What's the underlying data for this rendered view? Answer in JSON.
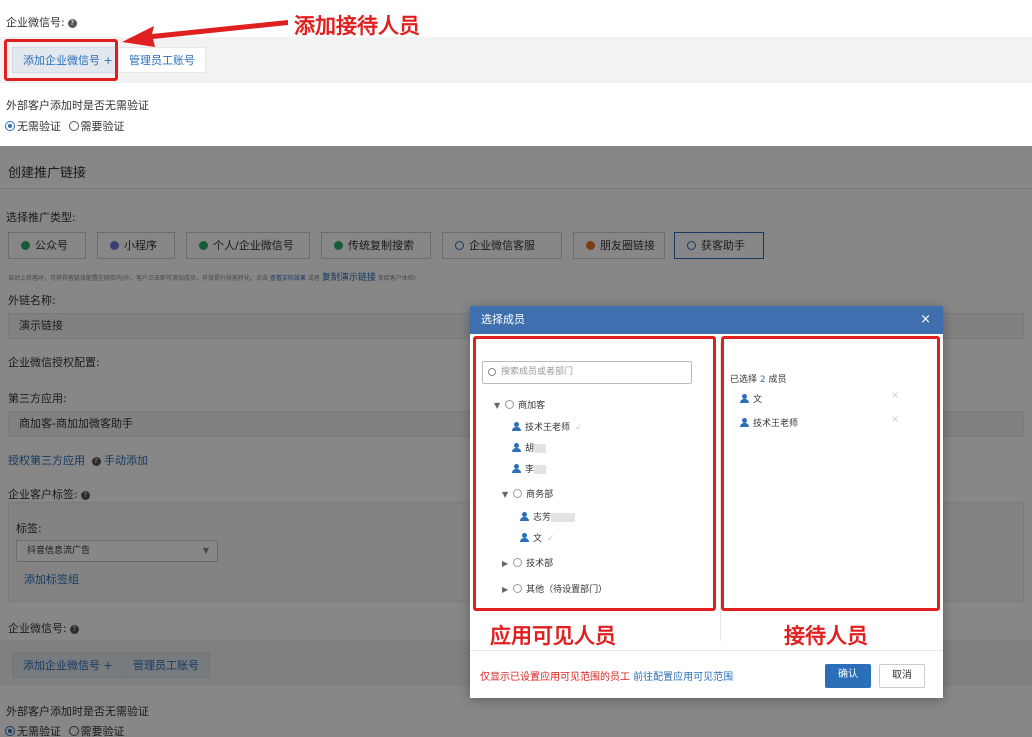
{
  "top": {
    "wechat_label": "企业微信号:",
    "add_button": "添加企业微信号 +",
    "manage_button": "管理员工账号",
    "verify_label": "外部客户添加时是否无需验证",
    "radio_no_verify": "无需验证",
    "radio_need_verify": "需要验证"
  },
  "annotation": {
    "callout_add_staff": "添加接待人员",
    "callout_visible": "应用可见人员",
    "callout_reception": "接待人员",
    "color": "#e02020"
  },
  "main": {
    "section_title": "创建推广链接",
    "type_label": "选择推广类型:",
    "types": [
      {
        "label": "公众号",
        "icon": "wechat-official-icon",
        "color": "#2aae67"
      },
      {
        "label": "小程序",
        "icon": "miniprogram-icon",
        "color": "#6a7bd8"
      },
      {
        "label": "个人/企业微信号",
        "icon": "wechat-icon",
        "color": "#2aae67"
      },
      {
        "label": "传统复制搜索",
        "icon": "search-copy-icon",
        "color": "#2aae67"
      },
      {
        "label": "企业微信客服",
        "icon": "service-icon",
        "color": "#2a6fb8"
      },
      {
        "label": "朋友圈链接",
        "icon": "moments-icon",
        "color": "#e8732a"
      },
      {
        "label": "获客助手",
        "icon": "search-icon",
        "color": "#2a6fb8"
      }
    ],
    "hint_text": "自动上获客时，可将获客链接配置在网页内/外，客户点击即可添加成员，有效提升获客转化。点击",
    "hint_link1": "查看实际效果",
    "hint_or": "或者",
    "hint_link2": "复制演示链接",
    "hint_tail": "发给客户体验!",
    "link_name_label": "外链名称:",
    "link_name_value": "演示链接",
    "auth_label": "企业微信授权配置:",
    "third_party_label": "第三方应用:",
    "third_party_value": "商加客-商加加微客助手",
    "auth_link": "授权第三方应用",
    "manual_add": "手动添加",
    "tag_label": "企业客户标签:",
    "tag_sub_label": "标签:",
    "tag_select_value": "抖音信息流广告",
    "add_tag_group": "添加标签组",
    "wechat_label2": "企业微信号:",
    "add_button2": "添加企业微信号 +",
    "manage_button2": "管理员工账号",
    "verify_label2": "外部客户添加时是否无需验证",
    "radio_no_verify2": "无需验证",
    "radio_need_verify2": "需要验证"
  },
  "modal": {
    "title": "选择成员",
    "search_placeholder": "搜索成员或者部门",
    "tree": {
      "root": "商加客",
      "root_members": [
        "技术王老师",
        "胡",
        "李"
      ],
      "sub_dept": "商务部",
      "sub_members": [
        "志芳",
        "文"
      ],
      "dept_tech": "技术部",
      "dept_other": "其他（待设置部门）"
    },
    "selected_prefix": "已选择",
    "selected_count": "2",
    "selected_suffix": "成员",
    "selected": [
      "文",
      "技术王老师"
    ],
    "footer_note": "仅显示已设置应用可见范围的员工",
    "footer_link": "前往配置应用可见范围",
    "confirm": "确认",
    "cancel": "取消"
  }
}
